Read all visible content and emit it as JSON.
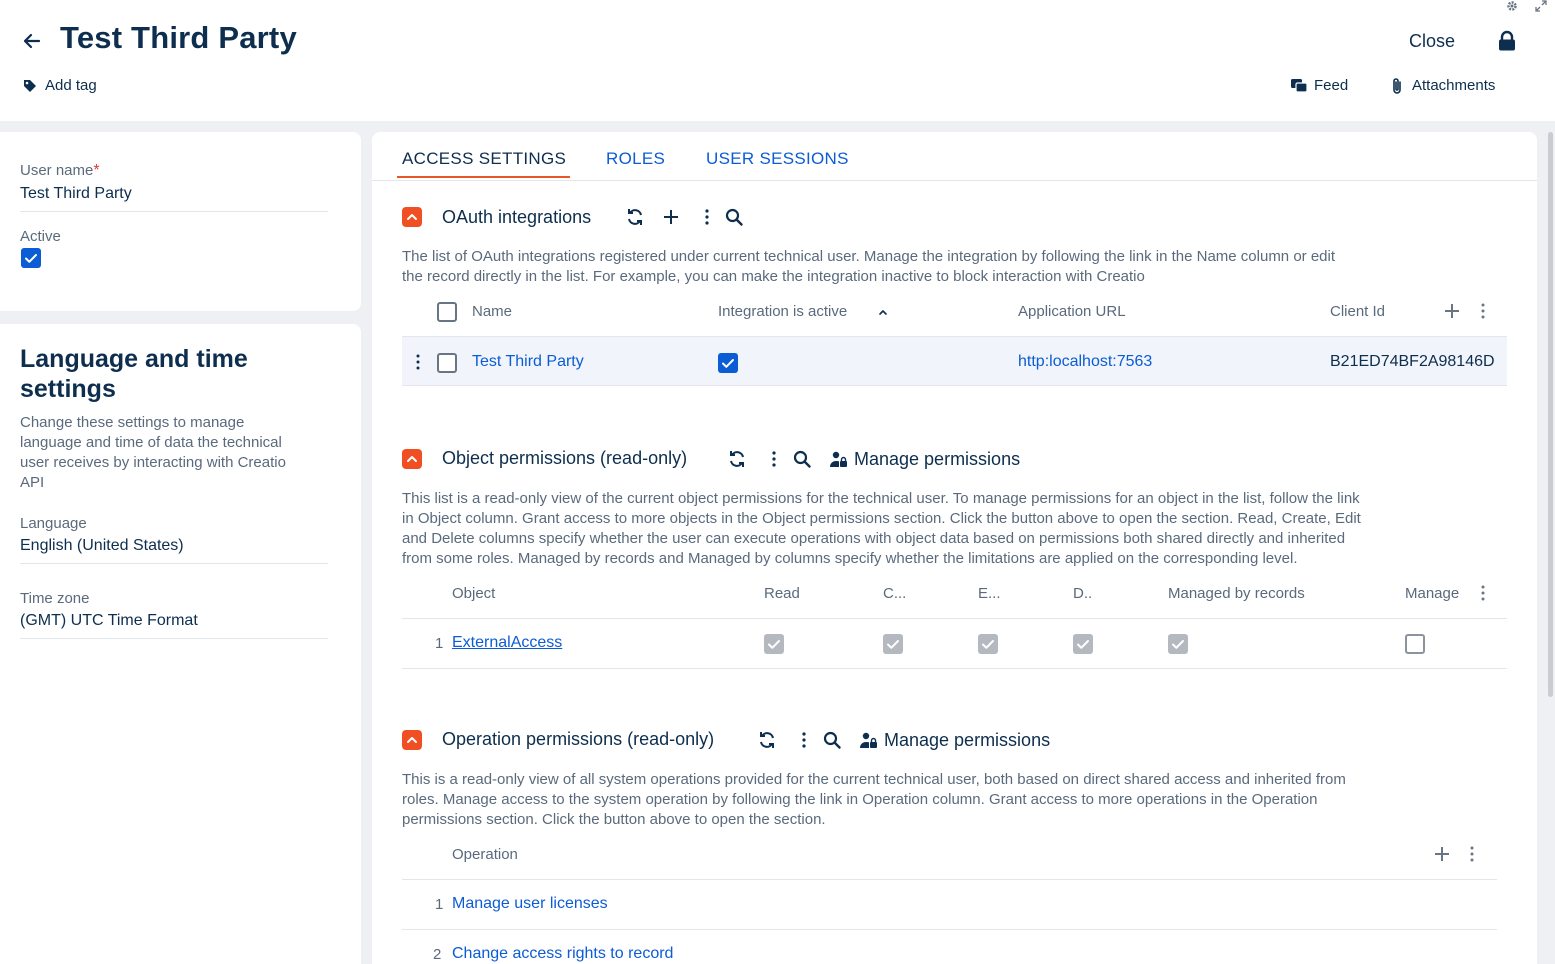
{
  "header": {
    "title": "Test Third Party",
    "add_tag": "Add tag",
    "close": "Close",
    "feed": "Feed",
    "attachments": "Attachments"
  },
  "left": {
    "user_name_label": "User name",
    "user_name_required": "*",
    "user_name_value": "Test Third Party",
    "active_label": "Active",
    "active_checked": true,
    "lang_section_title_line1": "Language and time",
    "lang_section_title_line2": "settings",
    "lang_section_desc_lines": [
      "Change these settings to manage",
      "language and time of data the technical",
      "user receives by interacting with Creatio",
      "API"
    ],
    "language_label": "Language",
    "language_value": "English (United States)",
    "timezone_label": "Time zone",
    "timezone_value": "(GMT) UTC Time Format"
  },
  "tabs": [
    {
      "label": "ACCESS SETTINGS",
      "active": true
    },
    {
      "label": "ROLES",
      "active": false
    },
    {
      "label": "USER SESSIONS",
      "active": false
    }
  ],
  "oauth": {
    "title": "OAuth integrations",
    "desc_lines": [
      "The list of OAuth integrations registered under current technical user. Manage the integration by following the link in the Name column or edit",
      "the record directly in the list. For example, you can make the integration inactive to block interaction with Creatio"
    ],
    "columns": [
      "Name",
      "Integration is active",
      "Application URL",
      "Client Id"
    ],
    "row": {
      "name": "Test Third Party",
      "active": true,
      "url": "http:localhost:7563",
      "client_id": "B21ED74BF2A98146D"
    }
  },
  "object_perm": {
    "title": "Object permissions (read-only)",
    "manage": "Manage permissions",
    "desc_lines": [
      "This list is a read-only view of the current object permissions for the technical user. To manage permissions for an object in the list, follow the link",
      "in Object column. Grant access to more objects in the Object permissions section. Click the button above to open the section. Read, Create, Edit",
      "and Delete columns specify whether the user can execute operations with object data based on permissions both shared directly and inherited",
      "from some roles. Managed by records and Managed by columns specify whether the limitations are applied on the corresponding level."
    ],
    "columns": [
      "Object",
      "Read",
      "C...",
      "E...",
      "D..",
      "Managed by records",
      "Manage"
    ],
    "row": {
      "num": "1",
      "object": "ExternalAccess"
    }
  },
  "operation_perm": {
    "title": "Operation permissions (read-only)",
    "manage": "Manage permissions",
    "desc_lines": [
      "This is a read-only view of all system operations provided for the current technical user, both based on direct shared access and inherited from",
      "roles. Manage access to the system operation by following the link in Operation column. Grant access to more operations in the Operation",
      "permissions section. Click the button above to open the section."
    ],
    "column": "Operation",
    "rows": [
      {
        "num": "1",
        "name": "Manage user licenses"
      },
      {
        "num": "2",
        "name": "Change access rights to record"
      }
    ]
  },
  "colors": {
    "accent": "#f04e23",
    "link": "#0b5cd5",
    "text": "#0d2e4e"
  }
}
